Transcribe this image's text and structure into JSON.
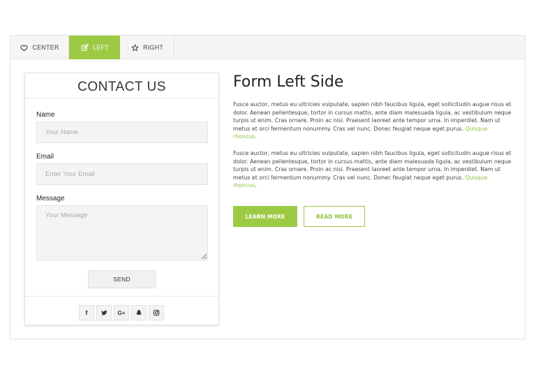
{
  "tabs": [
    {
      "label": "CENTER",
      "icon": "heart-icon"
    },
    {
      "label": "LEFT",
      "icon": "edit-icon",
      "active": true
    },
    {
      "label": "RIGHT",
      "icon": "star-icon"
    }
  ],
  "accent_color": "#9cca45",
  "form": {
    "title": "CONTACT US",
    "name_label": "Name",
    "name_placeholder": "Your Name",
    "email_label": "Email",
    "email_placeholder": "Enter Your Email",
    "message_label": "Message",
    "message_placeholder": "Your Message",
    "send_label": "SEND"
  },
  "socials": [
    {
      "name": "facebook-icon",
      "glyph": "f"
    },
    {
      "name": "twitter-icon",
      "glyph": ""
    },
    {
      "name": "google-plus-icon",
      "glyph": "G+"
    },
    {
      "name": "snapchat-icon",
      "glyph": ""
    },
    {
      "name": "instagram-icon",
      "glyph": ""
    }
  ],
  "content": {
    "heading": "Form Left Side",
    "paragraph1": "Fusce auctor, metus eu ultricies vulputate, sapien nibh faucibus ligula, eget sollicitudin augue risus et dolor. Aenean pellentesque, tortor in cursus mattis, ante diam malesuada ligula, ac vestibulum neque turpis ut enim. Cras ornare. Proin ac nisi. Praesent laoreet ante tempor urna. In imperdiet. Nam ut metus et orci fermentum nonummy. Cras vel nunc. Donec feugiat neque eget purus.",
    "link1": "Quisque rhoncus",
    "paragraph2": "Fusce auctor, metus eu ultricies vulputate, sapien nibh faucibus ligula, eget sollicitudin augue risus et dolor. Aenean pellentesque, tortor in cursus mattis, ante diam malesuada ligula, ac vestibulum neque turpis ut enim. Cras ornare. Proin ac nisi. Praesent laoreet ante tempor urna. In imperdiet. Nam ut metus et orci fermentum nonummy. Cras vel nunc. Donec feugiat neque eget purus.",
    "link2": "Quisque rhoncus",
    "learn_more": "LEARN MORE",
    "read_more": "READ MORE"
  }
}
